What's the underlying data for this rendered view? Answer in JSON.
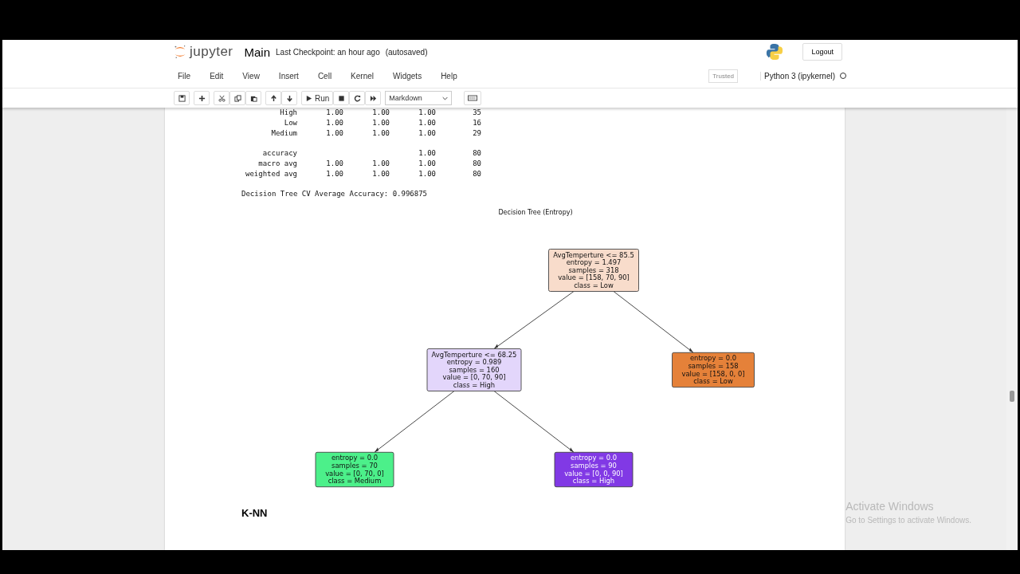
{
  "header": {
    "logo_text": "jupyter",
    "notebook_name": "Main",
    "checkpoint": "Last Checkpoint: an hour ago",
    "autosave": "(autosaved)",
    "logout": "Logout"
  },
  "menu": [
    "File",
    "Edit",
    "View",
    "Insert",
    "Cell",
    "Kernel",
    "Widgets",
    "Help"
  ],
  "trusted": "Trusted",
  "kernel": {
    "name": "Python 3 (ipykernel)",
    "busy": false
  },
  "toolbar": {
    "run": "Run",
    "cell_type": "Markdown"
  },
  "report": {
    "groups": [
      [
        {
          "label": "High",
          "precision": "1.00",
          "recall": "1.00",
          "f1_score": "1.00",
          "support": "35"
        },
        {
          "label": "Low",
          "precision": "1.00",
          "recall": "1.00",
          "f1_score": "1.00",
          "support": "16"
        },
        {
          "label": "Medium",
          "precision": "1.00",
          "recall": "1.00",
          "f1_score": "1.00",
          "support": "29"
        }
      ],
      [
        {
          "label": "accuracy",
          "f1_score": "1.00",
          "support": "80"
        },
        {
          "label": "macro avg",
          "precision": "1.00",
          "recall": "1.00",
          "f1_score": "1.00",
          "support": "80"
        },
        {
          "label": "weighted avg",
          "precision": "1.00",
          "recall": "1.00",
          "f1_score": "1.00",
          "support": "80"
        }
      ]
    ],
    "cv_line": "Decision Tree CV Average Accuracy: 0.996875"
  },
  "tree": {
    "title": "Decision Tree (Entropy)",
    "root": {
      "lines": [
        "AvgTemperture <= 85.5",
        "entropy = 1.497",
        "samples = 318",
        "value = [158, 70, 90]",
        "class = Low"
      ],
      "color": "#f8dccb",
      "children": [
        {
          "lines": [
            "AvgTemperture <= 68.25",
            "entropy = 0.989",
            "samples = 160",
            "value = [0, 70, 90]",
            "class = High"
          ],
          "color": "#e3d6fb",
          "children": [
            {
              "lines": [
                "entropy = 0.0",
                "samples = 70",
                "value = [0, 70, 0]",
                "class = Medium"
              ],
              "color": "#4cf08a"
            },
            {
              "lines": [
                "entropy = 0.0",
                "samples = 90",
                "value = [0, 0, 90]",
                "class = High"
              ],
              "color": "#8139e5"
            }
          ]
        },
        {
          "lines": [
            "entropy = 0.0",
            "samples = 158",
            "value = [158, 0, 0]",
            "class = Low"
          ],
          "color": "#e58139"
        }
      ]
    }
  },
  "next_heading": "K-NN",
  "activation": {
    "title": "Activate Windows",
    "subtitle": "Go to Settings to activate Windows."
  }
}
